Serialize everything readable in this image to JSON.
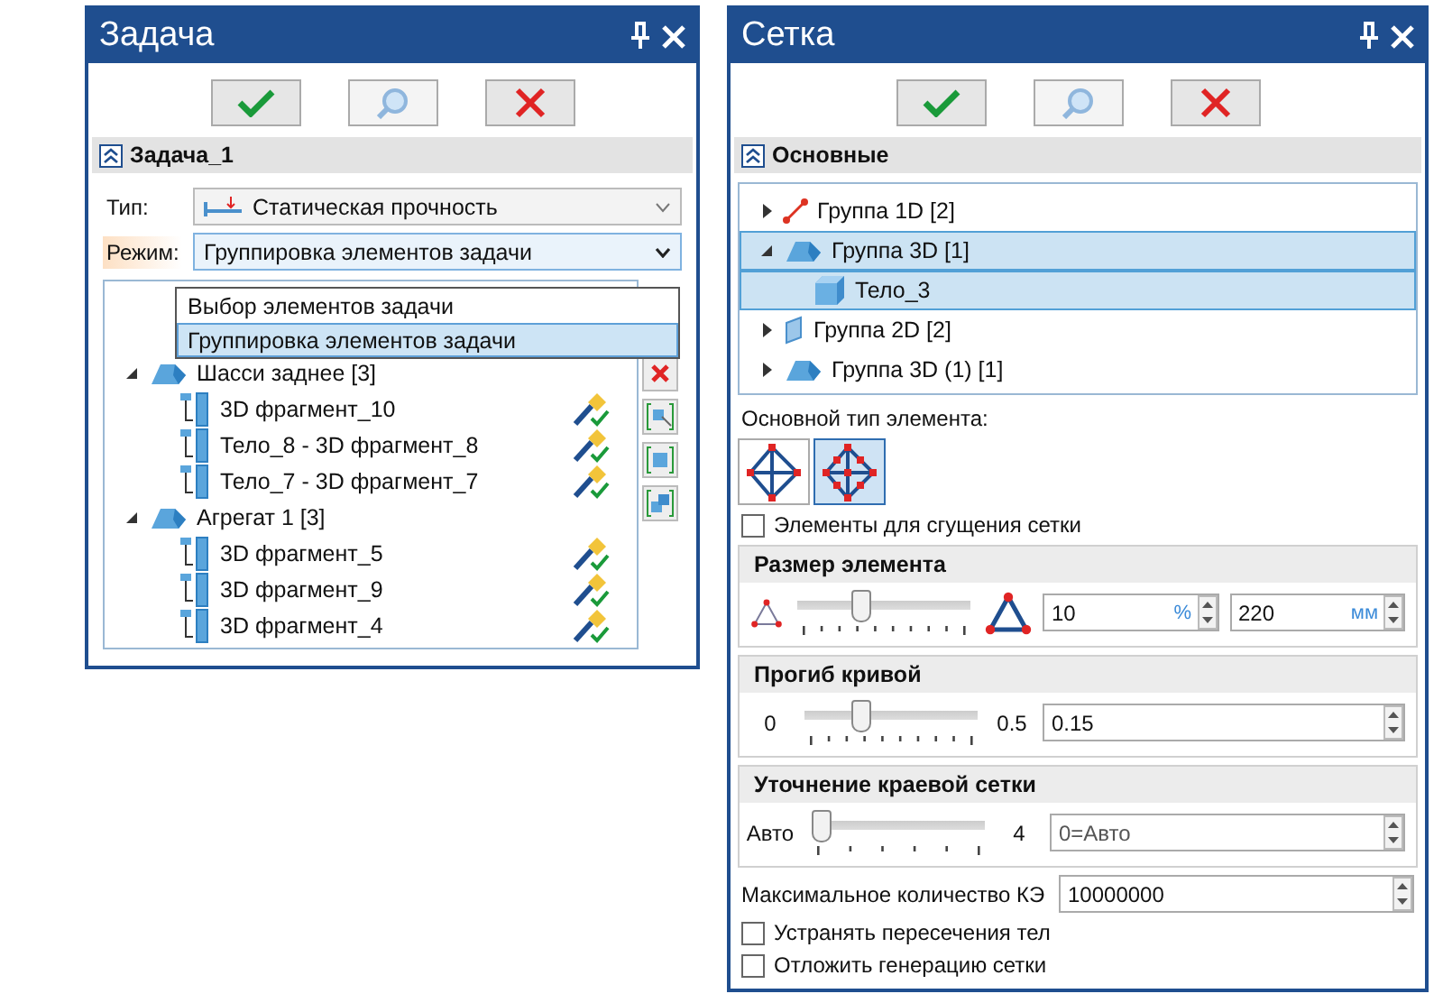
{
  "task_panel": {
    "title": "Задача",
    "toolbar": [
      {
        "kind": "ok",
        "disabled": false
      },
      {
        "kind": "preview",
        "disabled": true
      },
      {
        "kind": "cancel",
        "disabled": false
      }
    ],
    "section": {
      "title": "Задача_1",
      "expanded": true
    },
    "type_field": {
      "label": "Тип:",
      "value": "Статическая прочность"
    },
    "mode_field": {
      "label": "Режим:",
      "value": "Группировка элементов задачи",
      "highlighted": true,
      "open": true
    },
    "mode_options": [
      {
        "label": "Выбор элементов задачи",
        "selected": false
      },
      {
        "label": "Группировка элементов задачи",
        "selected": true
      }
    ],
    "tree": [
      {
        "label": "Шасси заднее [3]",
        "expanded": true,
        "children": [
          {
            "label": "3D фрагмент_10"
          },
          {
            "label": "Тело_8 - 3D фрагмент_8"
          },
          {
            "label": "Тело_7 - 3D фрагмент_7"
          }
        ]
      },
      {
        "label": "Агрегат 1 [3]",
        "expanded": true,
        "children": [
          {
            "label": "3D фрагмент_5"
          },
          {
            "label": "3D фрагмент_9"
          },
          {
            "label": "3D фрагмент_4"
          }
        ]
      }
    ],
    "side_tools": [
      {
        "kind": "delete"
      },
      {
        "kind": "select"
      },
      {
        "kind": "body"
      },
      {
        "kind": "bodies"
      }
    ]
  },
  "mesh_panel": {
    "title": "Сетка",
    "toolbar": [
      {
        "kind": "ok",
        "disabled": false
      },
      {
        "kind": "preview",
        "disabled": true
      },
      {
        "kind": "cancel",
        "disabled": false
      }
    ],
    "section": {
      "title": "Основные",
      "expanded": true
    },
    "tree": [
      {
        "label": "Группа 1D [2]",
        "kind": "line",
        "expanded": false,
        "selected": false
      },
      {
        "label": "Группа 3D [1]",
        "kind": "solid",
        "expanded": true,
        "selected": true,
        "children": [
          {
            "label": "Тело_3",
            "kind": "body",
            "selected": true
          }
        ]
      },
      {
        "label": "Группа 2D [2]",
        "kind": "shell",
        "expanded": false,
        "selected": false
      },
      {
        "label": "Группа 3D (1) [1]",
        "kind": "solid",
        "expanded": false,
        "selected": false
      }
    ],
    "element_type": {
      "label": "Основной тип элемента:",
      "options": [
        {
          "kind": "linear",
          "selected": false
        },
        {
          "kind": "quadratic",
          "selected": true
        }
      ]
    },
    "refine_checkbox": {
      "label": "Элементы для сгущения сетки",
      "checked": false
    },
    "element_size": {
      "title": "Размер элемента",
      "level": 0.35,
      "percent": {
        "value": "10",
        "unit": "%"
      },
      "absolute": {
        "value": "220",
        "unit": "мм"
      }
    },
    "curvature": {
      "title": "Прогиб кривой",
      "min": "0",
      "max": "0.5",
      "level": 0.3,
      "value": "0.15"
    },
    "edge_refinement": {
      "title": "Уточнение краевой сетки",
      "min": "Авто",
      "max": "4",
      "level": 0,
      "value": "0=Авто",
      "disabled": true
    },
    "max_elements": {
      "label": "Максимальное количество КЭ",
      "value": "10000000"
    },
    "checkboxes": [
      {
        "label": "Устранять пересечения тел",
        "checked": false
      },
      {
        "label": "Отложить генерацию сетки",
        "checked": false
      }
    ]
  }
}
